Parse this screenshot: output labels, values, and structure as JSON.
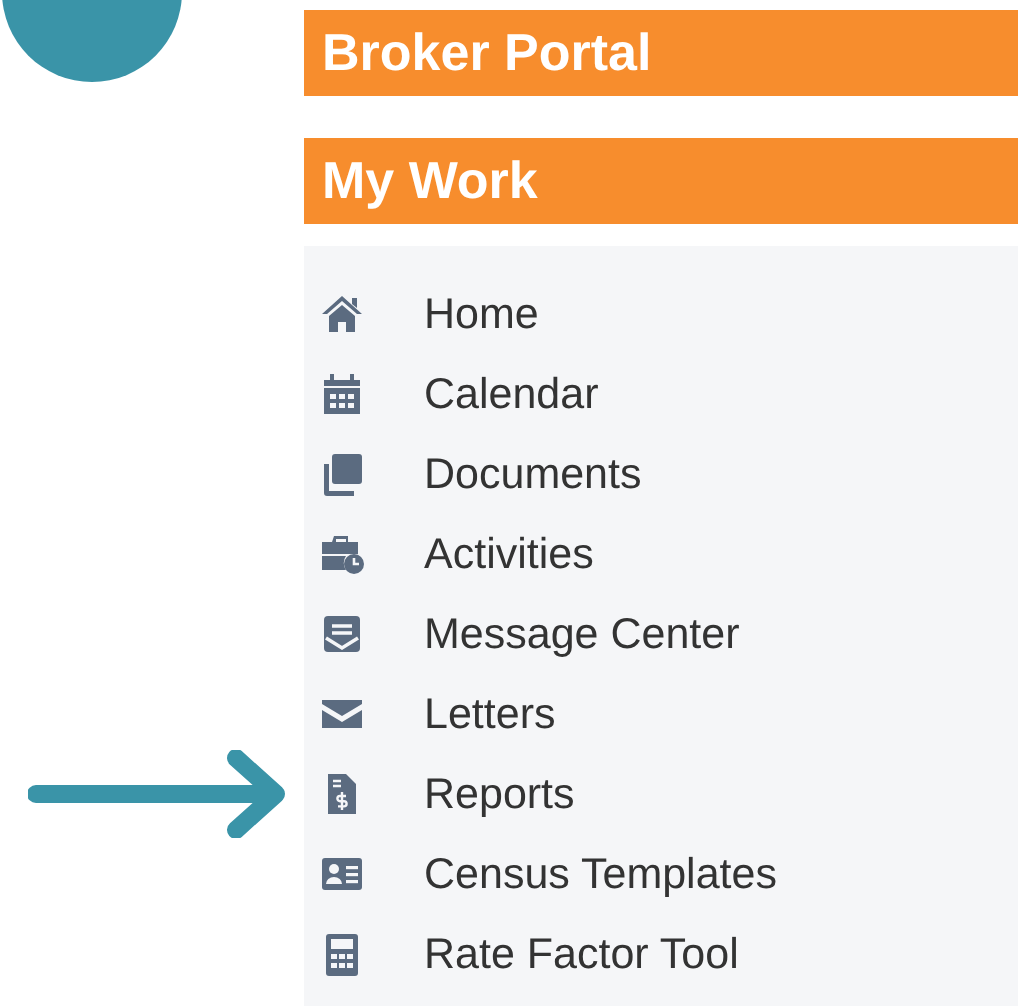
{
  "header": {
    "title": "Broker Portal"
  },
  "section": {
    "title": "My Work"
  },
  "menu": [
    {
      "label": "Home"
    },
    {
      "label": "Calendar"
    },
    {
      "label": "Documents"
    },
    {
      "label": "Activities"
    },
    {
      "label": "Message Center"
    },
    {
      "label": "Letters"
    },
    {
      "label": "Reports"
    },
    {
      "label": "Census Templates"
    },
    {
      "label": "Rate Factor Tool"
    }
  ]
}
